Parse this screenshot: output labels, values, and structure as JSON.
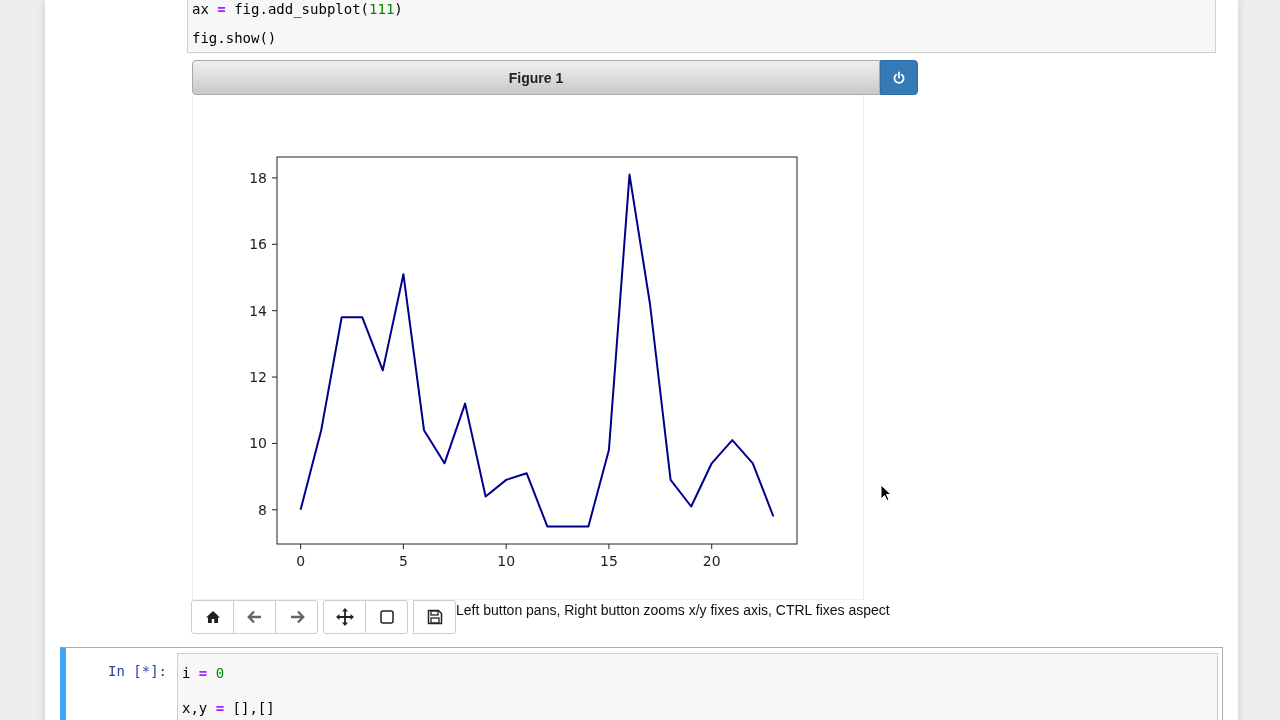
{
  "top_cell": {
    "lines": [
      [
        {
          "text": "ax ",
          "kind": "plain"
        },
        {
          "text": "=",
          "kind": "operator"
        },
        {
          "text": " fig.add_subplot(",
          "kind": "plain"
        },
        {
          "text": "111",
          "kind": "number"
        },
        {
          "text": ")",
          "kind": "plain"
        }
      ],
      [
        {
          "text": "fig.show()",
          "kind": "plain"
        }
      ]
    ]
  },
  "figure": {
    "title": "Figure 1",
    "chart_data": {
      "type": "line",
      "x": [
        0,
        1,
        2,
        3,
        4,
        5,
        6,
        7,
        8,
        9,
        10,
        11,
        12,
        13,
        14,
        15,
        16,
        17,
        18,
        19,
        20,
        21,
        22,
        23
      ],
      "series": [
        {
          "color": "#00008b",
          "values": [
            8,
            10.4,
            13.8,
            13.8,
            12.2,
            15.1,
            10.4,
            9.4,
            11.2,
            8.4,
            8.9,
            9.1,
            7.5,
            7.5,
            7.5,
            9.8,
            18.1,
            14.2,
            8.9,
            8.1,
            9.4,
            10.1,
            9.4,
            7.8
          ]
        }
      ],
      "xlim": [
        -1.15,
        24.15
      ],
      "ylim": [
        6.97,
        18.63
      ],
      "xticks": [
        0,
        5,
        10,
        15,
        20
      ],
      "yticks": [
        8,
        10,
        12,
        14,
        16,
        18
      ]
    },
    "toolbar": [
      {
        "kind": "home"
      },
      {
        "kind": "back"
      },
      {
        "kind": "forward"
      },
      {
        "kind": "pan"
      },
      {
        "kind": "zoom"
      },
      {
        "kind": "save"
      }
    ],
    "message": "Left button pans, Right button zooms x/y fixes axis, CTRL fixes aspect"
  },
  "bottom_cell": {
    "prompt": "In [*]:",
    "lines": [
      [
        {
          "text": "i ",
          "kind": "plain"
        },
        {
          "text": "= ",
          "kind": "operator"
        },
        {
          "text": "0",
          "kind": "number"
        }
      ],
      [
        {
          "text": "x,y ",
          "kind": "plain"
        },
        {
          "text": "=",
          "kind": "operator"
        },
        {
          "text": " [],[]",
          "kind": "plain"
        }
      ]
    ]
  }
}
